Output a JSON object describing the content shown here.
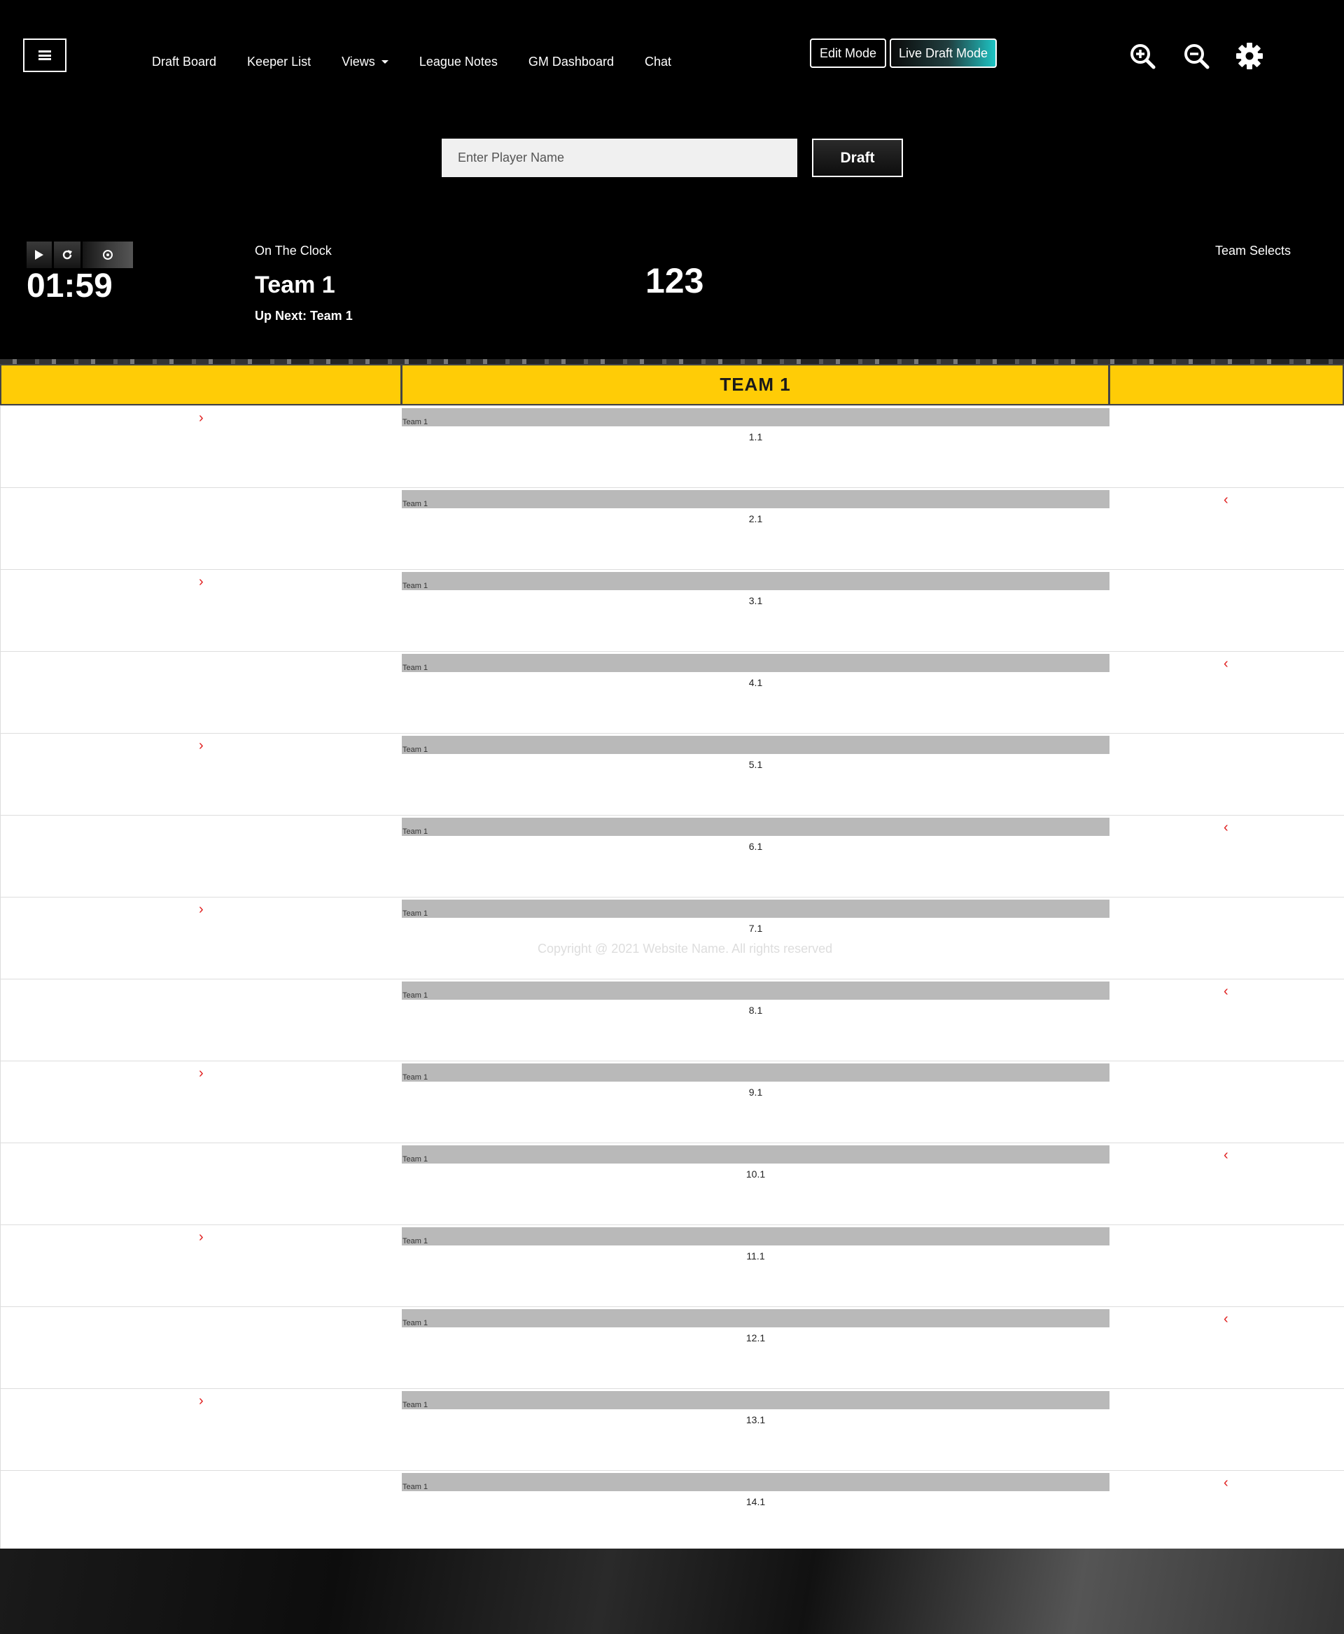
{
  "nav": {
    "items": [
      "Draft Board",
      "Keeper List",
      "Views",
      "League Notes",
      "GM Dashboard",
      "Chat"
    ]
  },
  "modes": {
    "edit": "Edit Mode",
    "live": "Live Draft Mode"
  },
  "icons": {
    "menu": "hamburger-icon",
    "zoom_in": "zoom-in-icon",
    "zoom_out": "zoom-out-icon",
    "settings": "gear-icon"
  },
  "search": {
    "placeholder": "Enter Player Name",
    "button": "Draft"
  },
  "clock": {
    "timer": "01:59",
    "on_the_clock_label": "On The Clock",
    "team": "Team 1",
    "up_next": "Up Next: Team 1",
    "pick_number": "123",
    "team_selects_label": "Team Selects"
  },
  "board": {
    "header_team": "TEAM 1",
    "picks": [
      {
        "team": "Team 1",
        "pick": "1.1"
      },
      {
        "team": "Team 1",
        "pick": "2.1"
      },
      {
        "team": "Team 1",
        "pick": "3.1"
      },
      {
        "team": "Team 1",
        "pick": "4.1"
      },
      {
        "team": "Team 1",
        "pick": "5.1"
      },
      {
        "team": "Team 1",
        "pick": "6.1"
      },
      {
        "team": "Team 1",
        "pick": "7.1"
      },
      {
        "team": "Team 1",
        "pick": "8.1"
      },
      {
        "team": "Team 1",
        "pick": "9.1"
      },
      {
        "team": "Team 1",
        "pick": "10.1"
      },
      {
        "team": "Team 1",
        "pick": "11.1"
      },
      {
        "team": "Team 1",
        "pick": "12.1"
      },
      {
        "team": "Team 1",
        "pick": "13.1"
      },
      {
        "team": "Team 1",
        "pick": "14.1"
      }
    ],
    "arrow_right": "›",
    "arrow_left": "‹"
  },
  "footer": {
    "copyright": "Copyright @ 2021 Website Name. All rights reserved"
  },
  "colors": {
    "header_yellow": "#ffcc06",
    "arrow_red": "#e01e1e",
    "live_mode_accent": "#1ec4c4"
  }
}
